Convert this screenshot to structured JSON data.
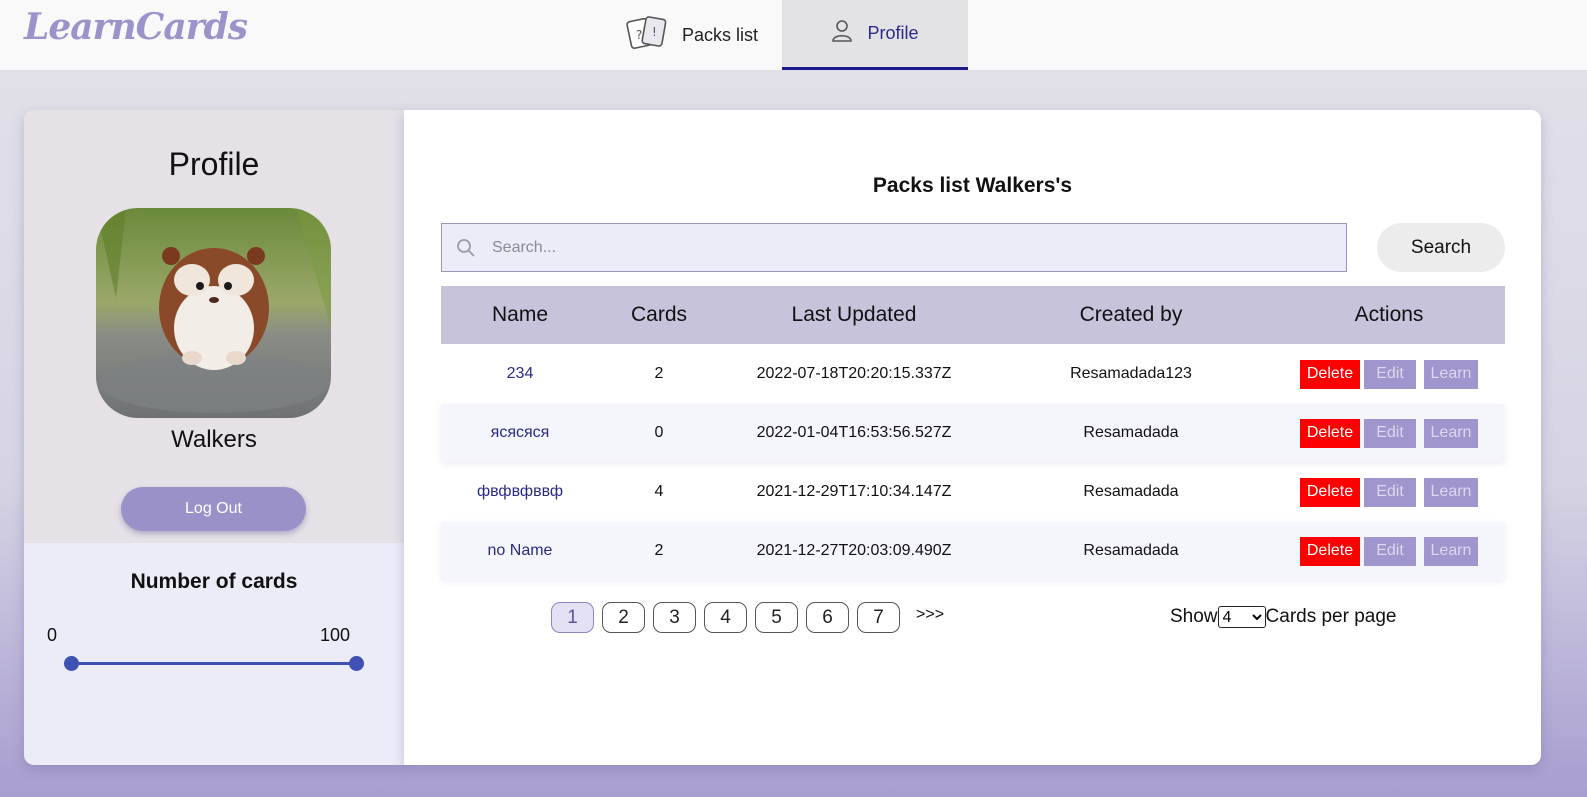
{
  "app": {
    "logo": "LearnCards"
  },
  "nav": {
    "tabs": [
      {
        "label": "Packs list",
        "icon": "cards-icon",
        "active": false
      },
      {
        "label": "Profile",
        "icon": "user-icon",
        "active": true
      }
    ]
  },
  "profile": {
    "title": "Profile",
    "username": "Walkers",
    "logout_label": "Log Out",
    "avatar": "hamster-photo"
  },
  "filter": {
    "title": "Number of cards",
    "min": "0",
    "max": "100",
    "range": [
      0,
      100
    ]
  },
  "packs": {
    "title": "Packs list Walkers's",
    "search_placeholder": "Search...",
    "search_button": "Search",
    "columns": [
      "Name",
      "Cards",
      "Last Updated",
      "Created by",
      "Actions"
    ],
    "rows": [
      {
        "name": "234",
        "cards": "2",
        "updated": "2022-07-18T20:20:15.337Z",
        "created_by": "Resamadada123"
      },
      {
        "name": "ясяcяся",
        "cards": "0",
        "updated": "2022-01-04T16:53:56.527Z",
        "created_by": "Resamadada"
      },
      {
        "name": "фвфвфввф",
        "cards": "4",
        "updated": "2021-12-29T17:10:34.147Z",
        "created_by": "Resamadada"
      },
      {
        "name": "no Name",
        "cards": "2",
        "updated": "2021-12-27T20:03:09.490Z",
        "created_by": "Resamadada"
      }
    ],
    "actions": {
      "delete": "Delete",
      "edit": "Edit",
      "learn": "Learn"
    }
  },
  "pagination": {
    "pages": [
      "1",
      "2",
      "3",
      "4",
      "5",
      "6",
      "7"
    ],
    "current": "1",
    "next": ">>>",
    "show_label": "Show",
    "per_page_value": "4",
    "per_page_label": "Cards per page"
  },
  "colors": {
    "accent": "#9a91c9",
    "delete": "#ff0000",
    "header_row": "#c6c3da",
    "slider": "#3f51b5"
  }
}
